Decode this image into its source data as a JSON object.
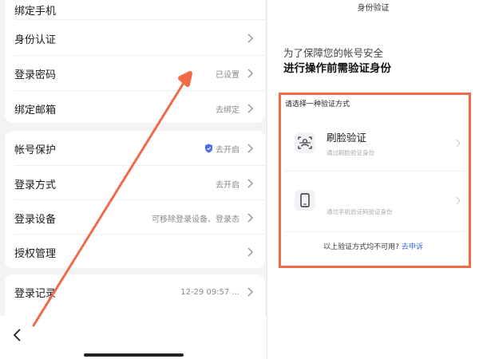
{
  "settings": {
    "rows": [
      {
        "label": "绑定手机",
        "value": ""
      },
      {
        "label": "身份认证",
        "value": ""
      },
      {
        "label": "登录密码",
        "value": "已设置"
      },
      {
        "label": "绑定邮箱",
        "value": "去绑定"
      },
      {
        "label": "帐号保护",
        "value": "去开启"
      },
      {
        "label": "登录方式",
        "value": "去开启"
      },
      {
        "label": "登录设备",
        "value": "可移除登录设备、登录态"
      },
      {
        "label": "授权管理",
        "value": ""
      },
      {
        "label": "登录记录",
        "value": "12-29 09:57 ..."
      }
    ]
  },
  "verify": {
    "title": "身份验证",
    "intro_line1": "为了保障您的帐号安全",
    "intro_line2": "进行操作前需验证身份",
    "choose_label": "请选择一种验证方式",
    "options": [
      {
        "title": "刷脸验证",
        "subtitle": "通过刷脸验证身份",
        "icon": "face-scan-icon"
      },
      {
        "title": "",
        "subtitle": "通过手机验证码验证身份",
        "icon": "phone-icon"
      }
    ],
    "unavailable_text": "以上验证方式均不可用?",
    "appeal_link": "去申诉"
  },
  "colors": {
    "highlight": "#ef6b48",
    "link": "#3a6fd8",
    "shield": "#4a6cf0"
  }
}
